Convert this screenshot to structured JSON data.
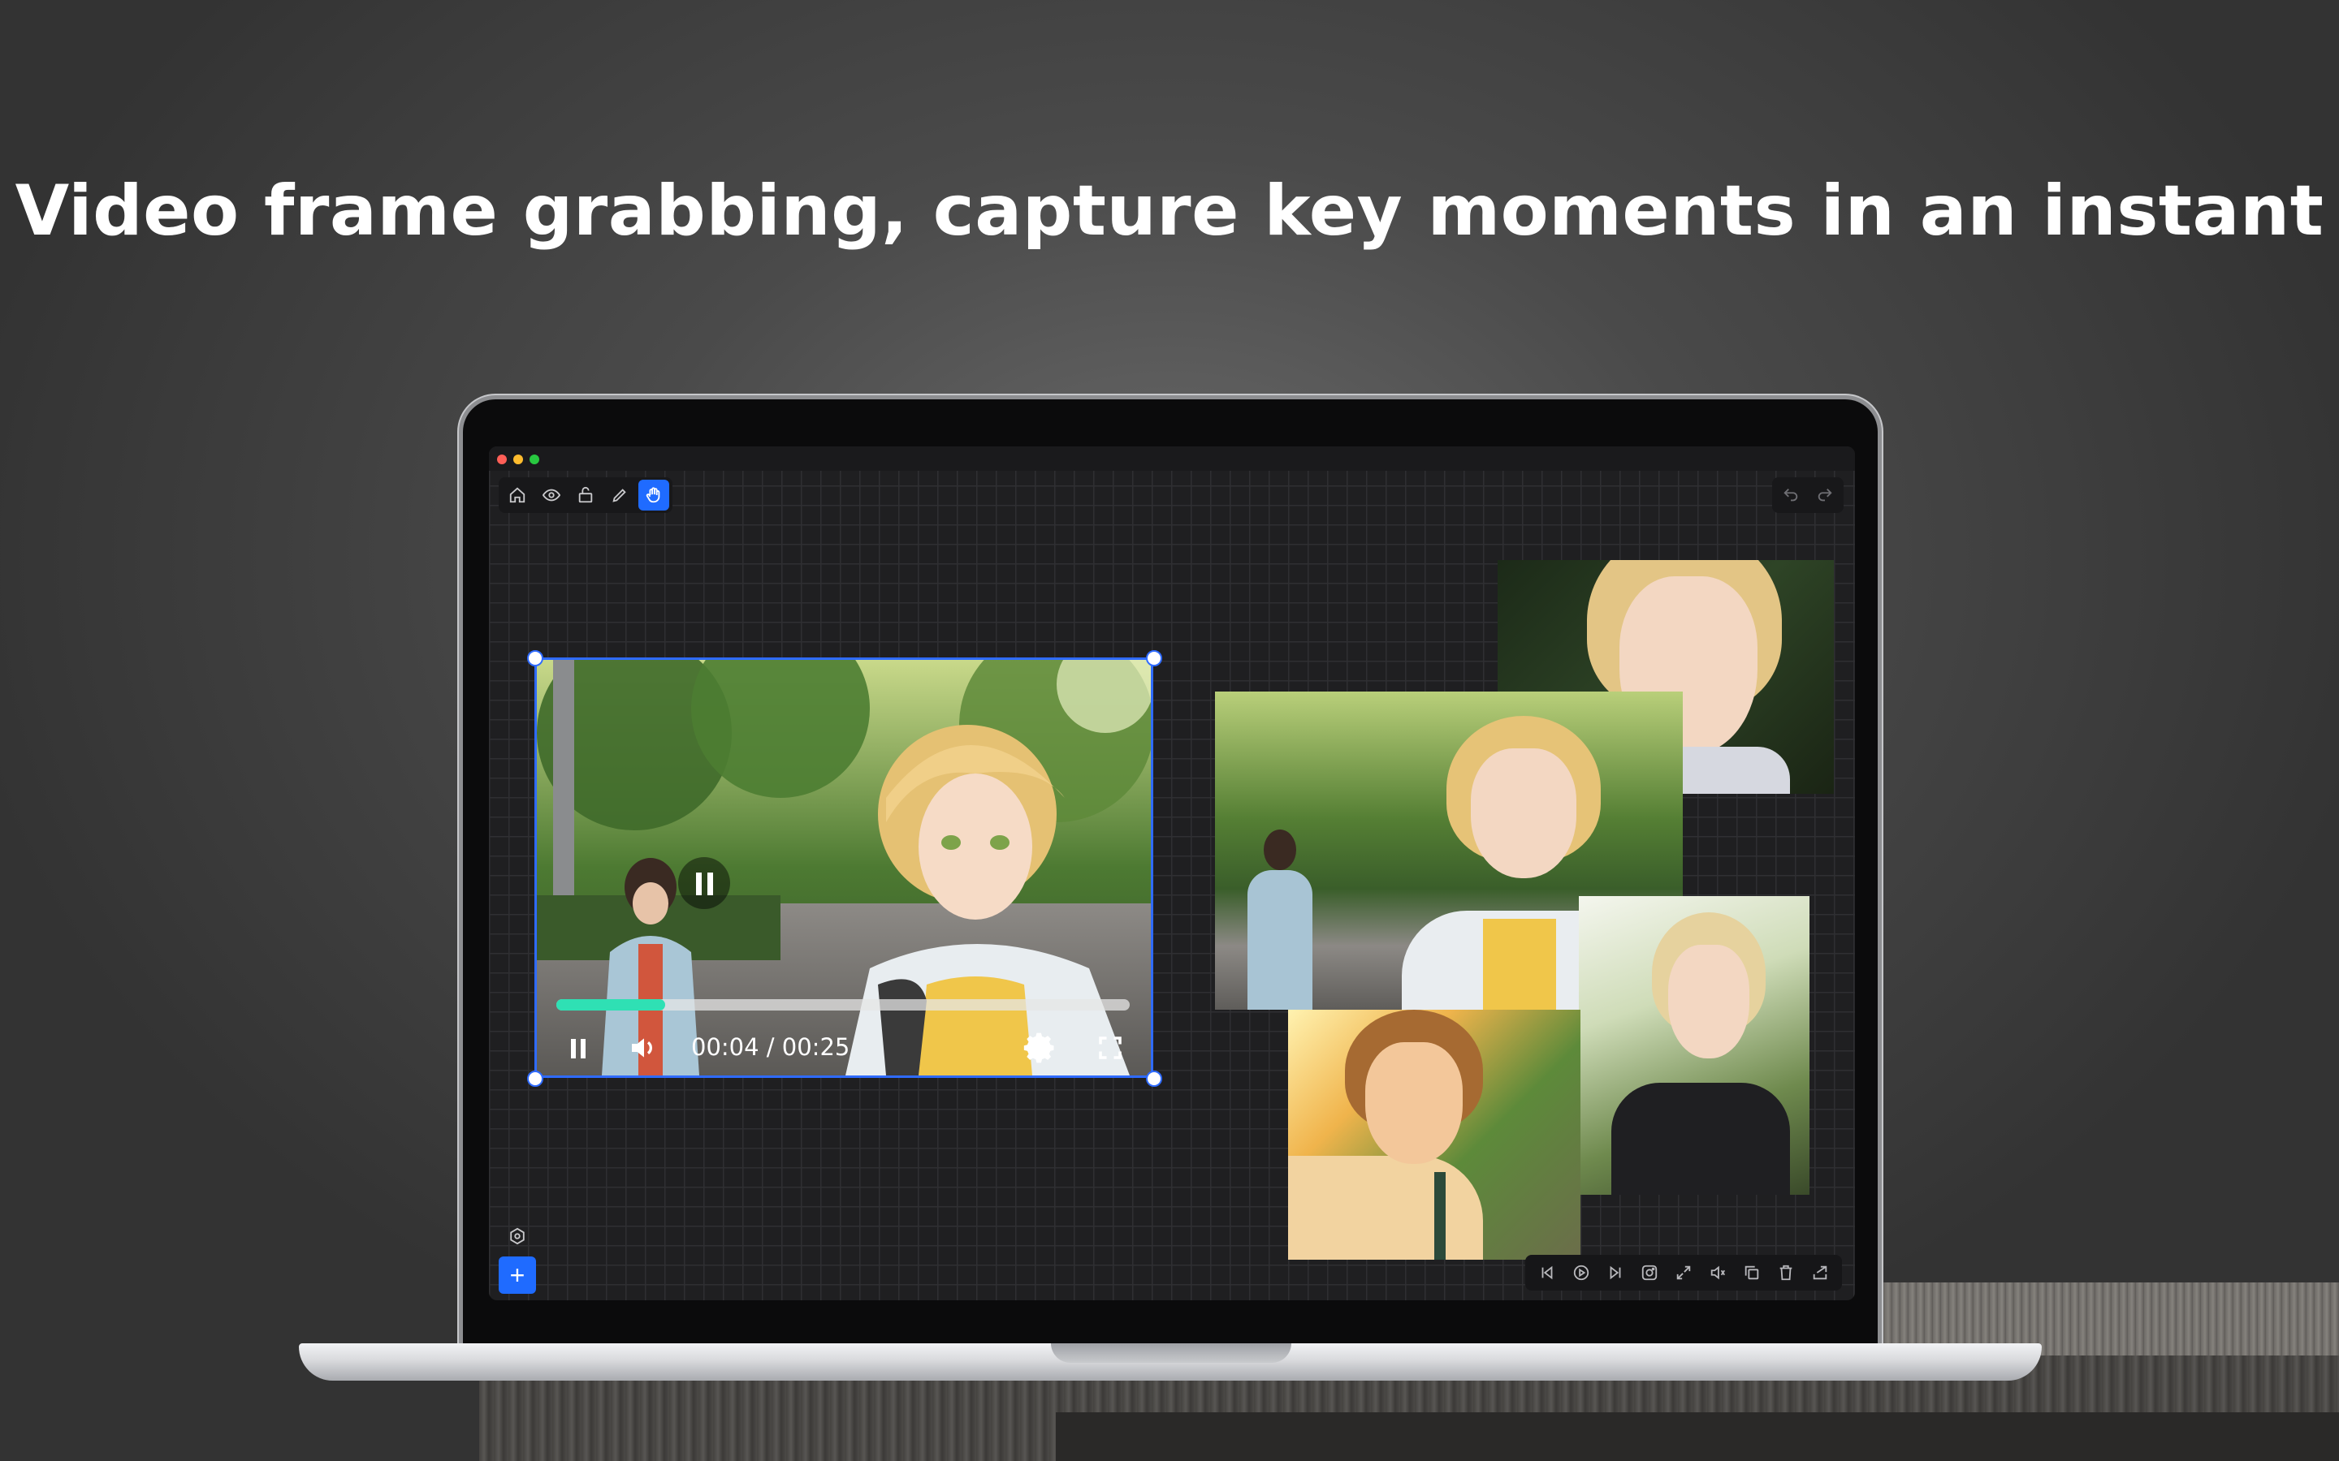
{
  "headline": "Video frame grabbing, capture key moments in an instant",
  "window_controls": {
    "colors": [
      "#ff5f57",
      "#febc2e",
      "#28c840"
    ]
  },
  "toolbar": {
    "tools": [
      "home-icon",
      "eye-icon",
      "lock-icon",
      "pen-icon",
      "hand-icon"
    ],
    "active_tool": "hand-icon",
    "undo": "undo-icon",
    "redo": "redo-icon"
  },
  "video_player": {
    "time": "00:04 / 00:25",
    "progress": 0.19,
    "accent": "#2fe0b4",
    "selection_color": "#2f6bff"
  },
  "bottom_toolbar": {
    "tools": [
      "previous-frame-icon",
      "play-icon",
      "next-frame-icon",
      "capture-icon",
      "expand-icon",
      "volume-icon",
      "copy-icon",
      "delete-icon",
      "share-icon"
    ]
  },
  "left_actions": {
    "settings": "settings-icon",
    "add": "+"
  },
  "accent": "#1f6bff"
}
